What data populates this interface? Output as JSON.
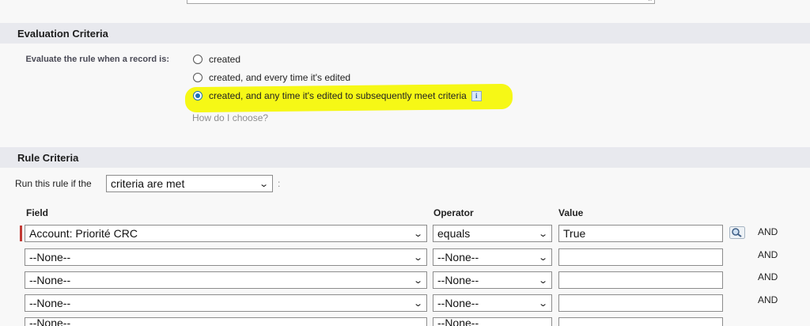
{
  "evaluation": {
    "section_title": "Evaluation Criteria",
    "label": "Evaluate the rule when a record is:",
    "options": [
      {
        "label": "created",
        "checked": false
      },
      {
        "label": "created, and every time it's edited",
        "checked": false
      },
      {
        "label": "created, and any time it's edited to subsequently meet criteria",
        "checked": true
      }
    ],
    "help_link": "How do I choose?",
    "info_icon": "i"
  },
  "rule": {
    "section_title": "Rule Criteria",
    "run_label": "Run this rule if the",
    "run_select": "criteria are met",
    "colon": ":",
    "headers": {
      "field": "Field",
      "operator": "Operator",
      "value": "Value"
    },
    "rows": [
      {
        "field": "Account: Priorité CRC",
        "operator": "equals",
        "value": "True",
        "logic": "AND"
      },
      {
        "field": "--None--",
        "operator": "--None--",
        "value": "",
        "logic": "AND"
      },
      {
        "field": "--None--",
        "operator": "--None--",
        "value": "",
        "logic": "AND"
      },
      {
        "field": "--None--",
        "operator": "--None--",
        "value": "",
        "logic": "AND"
      },
      {
        "field": "--None--",
        "operator": "--None--",
        "value": "",
        "logic": ""
      }
    ]
  },
  "icons": {
    "chevron": "chevron-down-icon",
    "lookup": "lookup-icon",
    "resize": "resize-grip-icon"
  },
  "colors": {
    "highlight": "#f5f80a",
    "required": "#c23934",
    "section_bg": "#e8e9ee"
  }
}
